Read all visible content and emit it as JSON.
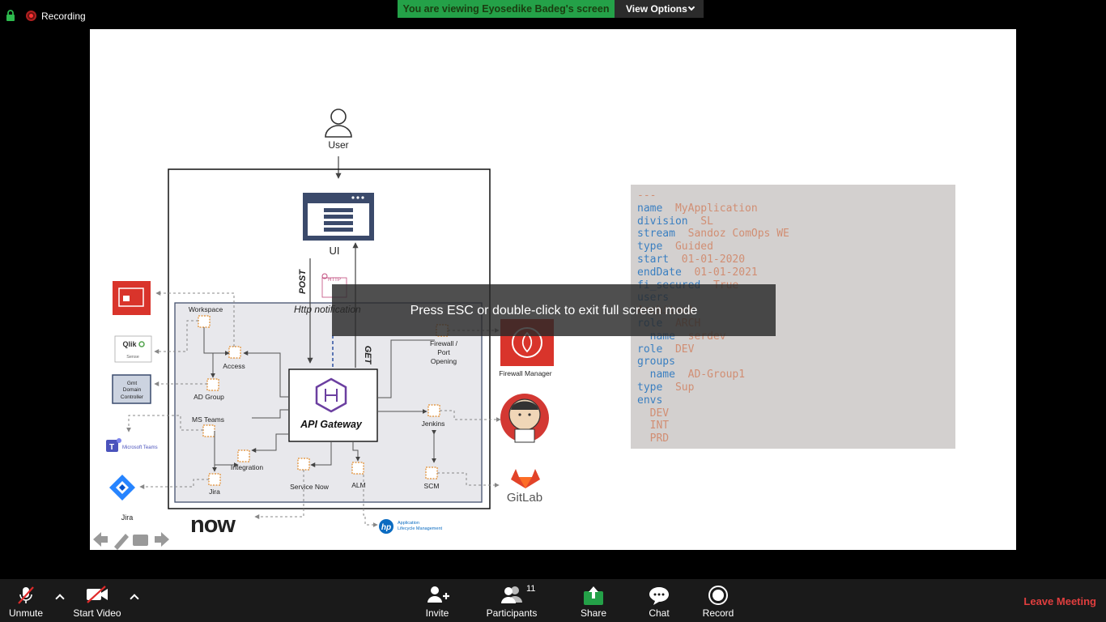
{
  "top_bar": {
    "recording_label": "Recording",
    "viewing_banner": "You are viewing Eyosedike Badeg's screen",
    "view_options_label": "View Options"
  },
  "diagram": {
    "user_label": "User",
    "ui_label": "UI",
    "post_label": "POST",
    "get_label": "GET",
    "http_notification_label": "Http notification",
    "api_gateway_label": "API Gateway",
    "workspace_label": "Workspace",
    "access_label": "Access",
    "ad_group_label": "AD Group",
    "ms_teams_label": "MS Teams",
    "integration_label": "Integration",
    "jira_label": "Jira",
    "service_now_label": "Service Now",
    "alm_label": "ALM",
    "firewall_port_label_1": "Firewall /",
    "firewall_port_label_2": "Port",
    "firewall_port_label_3": "Opening",
    "jenkins_label": "Jenkins",
    "scm_label": "SCM",
    "firewall_manager_label": "Firewall Manager",
    "gitlab_label": "GitLab",
    "jira_logo_label": "Jira",
    "qlik_label": "Qlik",
    "qlik_sense_label": "Sense",
    "gmt_label_1": "Gmt",
    "gmt_label_2": "Domain",
    "gmt_label_3": "Controller",
    "ms_teams_logo_label": "Microsoft Teams",
    "now_logo_label": "now",
    "hp_alm_label_1": "Application",
    "hp_alm_label_2": "Lifecycle Management",
    "http_tag": "HTTP"
  },
  "yaml_lines": [
    {
      "k": "---",
      "v": ""
    },
    {
      "k": "name",
      "v": "MyApplication"
    },
    {
      "k": "division",
      "v": "SL"
    },
    {
      "k": "stream",
      "v": "Sandoz ComOps WE"
    },
    {
      "k": "type",
      "v": "Guided"
    },
    {
      "k": "start",
      "v": "01-01-2020"
    },
    {
      "k": "endDate",
      "v": "01-01-2021"
    },
    {
      "k": "fi_secured",
      "v": "True"
    },
    {
      "k": "users",
      "v": ""
    },
    {
      "k": "",
      "v": "Architect"
    },
    {
      "k": "role",
      "v": "ARCH"
    },
    {
      "k": "  name",
      "v": "serdev"
    },
    {
      "k": "role",
      "v": "DEV"
    },
    {
      "k": "groups",
      "v": ""
    },
    {
      "k": "  name",
      "v": "AD-Group1"
    },
    {
      "k": "type",
      "v": "Sup"
    },
    {
      "k": "envs",
      "v": ""
    },
    {
      "k": "",
      "v": "  DEV"
    },
    {
      "k": "",
      "v": "  INT"
    },
    {
      "k": "",
      "v": "  PRD"
    }
  ],
  "esc_message": "Press ESC or double-click to exit full screen mode",
  "toolbar": {
    "unmute": "Unmute",
    "start_video": "Start Video",
    "invite": "Invite",
    "participants": "Participants",
    "participants_count": "11",
    "share": "Share",
    "chat": "Chat",
    "record": "Record",
    "leave": "Leave Meeting"
  },
  "colors": {
    "zoom_green": "#24a148",
    "leave_red": "#e03e3e",
    "yaml_key": "#3a7fc1",
    "yaml_value": "#d18e73",
    "api_gateway_purple": "#6b3fa0",
    "firewall_red": "#d9342b",
    "gitlab_orange": "#e24329",
    "jira_blue": "#2684ff"
  }
}
